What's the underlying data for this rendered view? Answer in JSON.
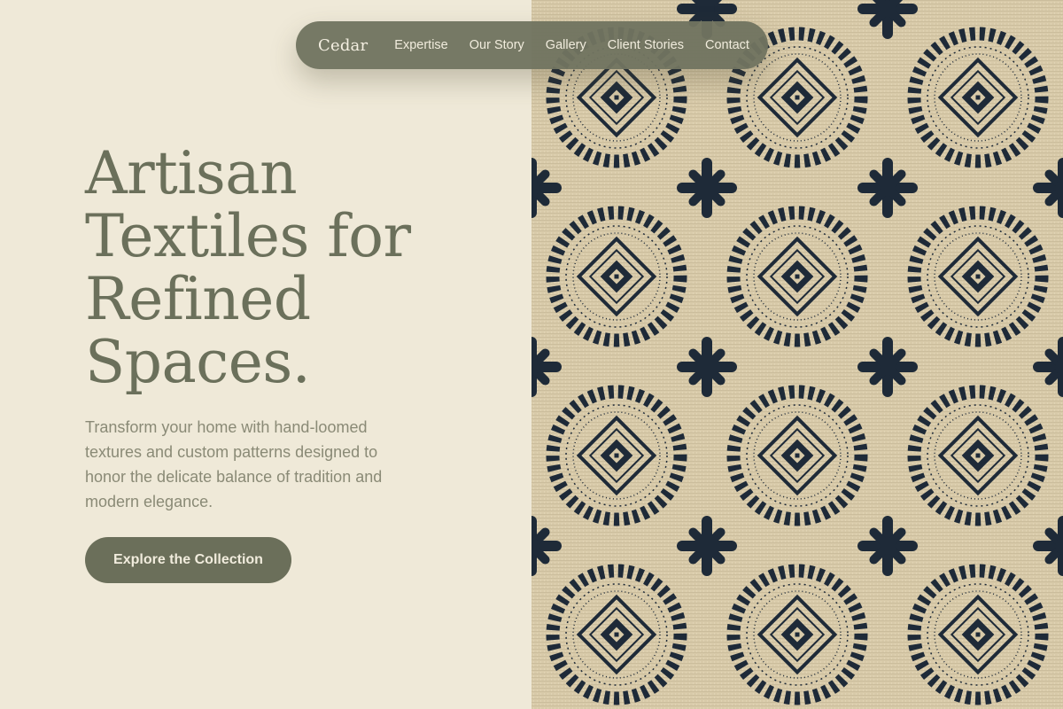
{
  "nav": {
    "brand": "Cedar",
    "links": [
      {
        "label": "Expertise"
      },
      {
        "label": "Our Story"
      },
      {
        "label": "Gallery"
      },
      {
        "label": "Client Stories"
      },
      {
        "label": "Contact"
      }
    ]
  },
  "hero": {
    "title_lines": [
      "Artisan",
      "Textiles for",
      "Refined",
      "Spaces."
    ],
    "description": "Transform your home with hand-loomed textures and custom patterns designed to honor the delicate balance of tradition and modern elegance.",
    "cta_label": "Explore the Collection"
  },
  "image": {
    "icon": "woven-textile-pattern-image"
  },
  "colors": {
    "background": "#efe9d8",
    "nav_bg": "#707460",
    "title": "#6b705b",
    "body_text": "#8a8a76",
    "button_bg": "#6b6f5a",
    "textile_navy": "#1e2a38",
    "textile_cream": "#d6c7a6"
  }
}
